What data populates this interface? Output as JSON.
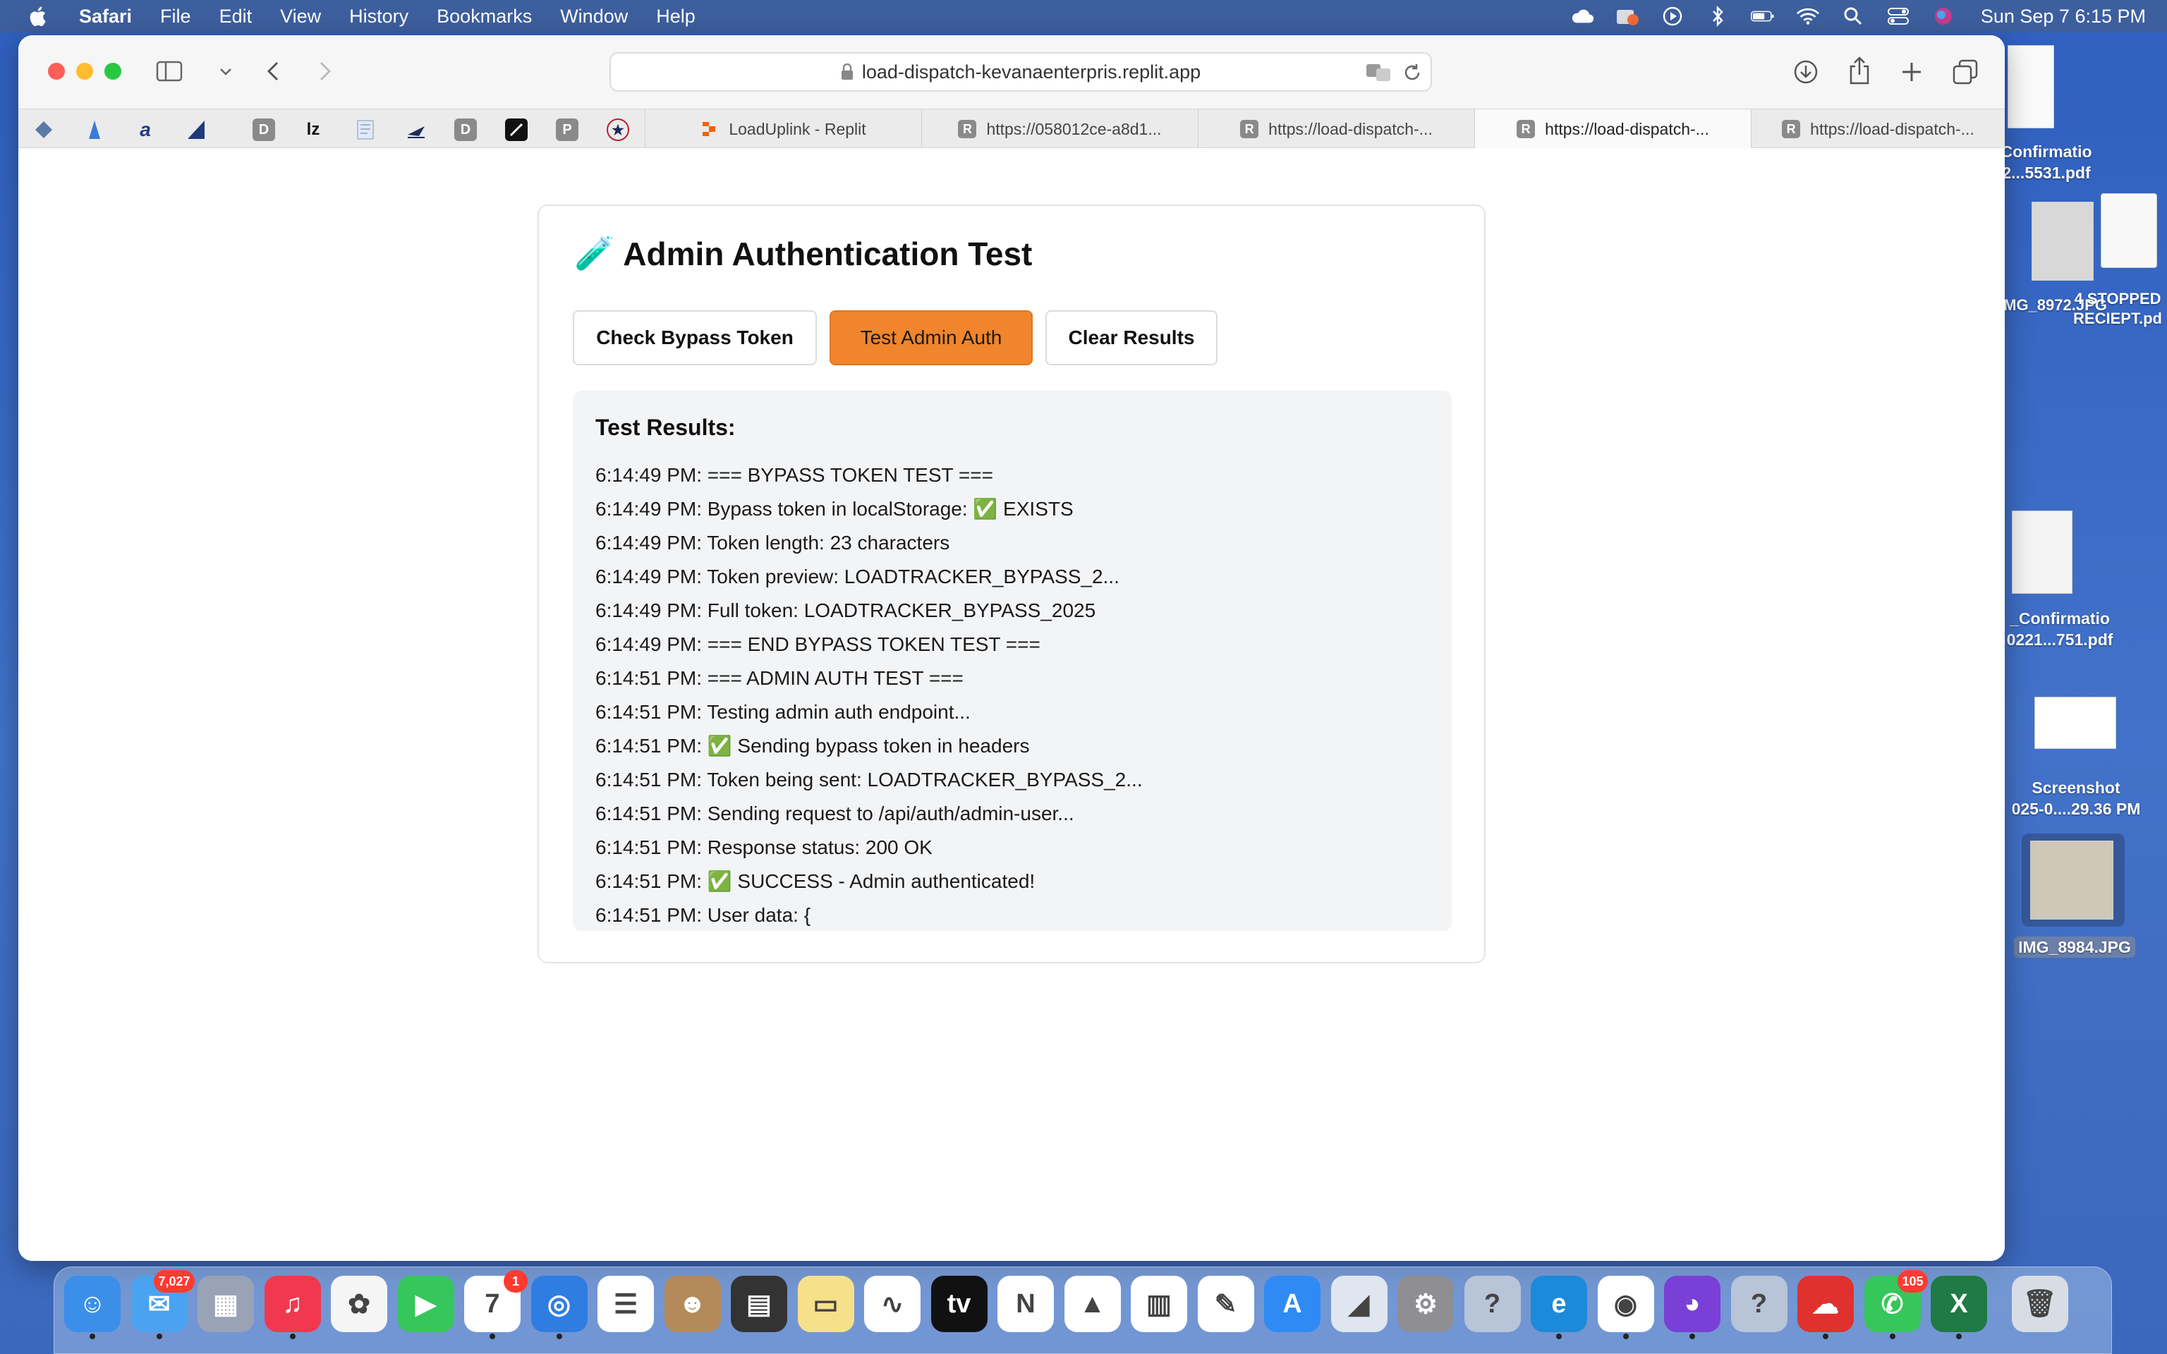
{
  "menubar": {
    "app": "Safari",
    "items": [
      "File",
      "Edit",
      "View",
      "History",
      "Bookmarks",
      "Window",
      "Help"
    ],
    "clock": "Sun Sep 7  6:15 PM"
  },
  "browser": {
    "url": "load-dispatch-kevanaenterpris.replit.app",
    "favorites": [
      {
        "icon": "diamond-icon",
        "color": "#5b7aa6",
        "letter": ""
      },
      {
        "icon": "rocket-icon",
        "color": "#3b7bd6",
        "letter": ""
      },
      {
        "icon": "a-icon",
        "color": "#ffffff",
        "letter": "a"
      },
      {
        "icon": "flag-icon",
        "color": "#1e3a7a",
        "letter": ""
      },
      {
        "icon": "d-icon",
        "color": "#8a8a8a",
        "letter": "D"
      },
      {
        "icon": "lz-icon",
        "color": "#ffffff",
        "letter": "lz"
      },
      {
        "icon": "doc-icon",
        "color": "#c9d6e8",
        "letter": ""
      },
      {
        "icon": "plane-icon",
        "color": "#ffffff",
        "letter": ""
      },
      {
        "icon": "d-icon",
        "color": "#8a8a8a",
        "letter": "D"
      },
      {
        "icon": "pen-icon",
        "color": "#111111",
        "letter": ""
      },
      {
        "icon": "p-icon",
        "color": "#8a8a8a",
        "letter": "P"
      },
      {
        "icon": "star-icon",
        "color": "#ffffff",
        "letter": "★"
      }
    ],
    "tabs": [
      {
        "label": "LoadUplink - Replit",
        "icon": "replit-icon"
      },
      {
        "label": "https://058012ce-a8d1...",
        "icon": "R"
      },
      {
        "label": "https://load-dispatch-...",
        "icon": "R"
      },
      {
        "label": "https://load-dispatch-...",
        "icon": "R"
      },
      {
        "label": "https://load-dispatch-...",
        "icon": "R"
      }
    ]
  },
  "page": {
    "title": "Admin Authentication Test",
    "title_emoji": "🧪",
    "buttons": {
      "check": "Check Bypass Token",
      "test": "Test Admin Auth",
      "clear": "Clear Results"
    },
    "results_heading": "Test Results:",
    "log": [
      "6:14:49 PM: === BYPASS TOKEN TEST ===",
      "6:14:49 PM: Bypass token in localStorage: ✅ EXISTS",
      "6:14:49 PM: Token length: 23 characters",
      "6:14:49 PM: Token preview: LOADTRACKER_BYPASS_2...",
      "6:14:49 PM: Full token: LOADTRACKER_BYPASS_2025",
      "6:14:49 PM: === END BYPASS TOKEN TEST ===",
      "6:14:51 PM: === ADMIN AUTH TEST ===",
      "6:14:51 PM: Testing admin auth endpoint...",
      "6:14:51 PM: ✅ Sending bypass token in headers",
      "6:14:51 PM: Token being sent: LOADTRACKER_BYPASS_2...",
      "6:14:51 PM: Sending request to /api/auth/admin-user...",
      "6:14:51 PM: Response status: 200 OK",
      "6:14:51 PM: ✅ SUCCESS - Admin authenticated!",
      "6:14:51 PM: User data: {"
    ]
  },
  "desktop": {
    "icons": [
      {
        "label1": "Confirmatio",
        "label2": "2...5531.pdf"
      },
      {
        "label1": "IMG_8972.JPG",
        "label2": ""
      },
      {
        "label1": "4 STOPPED",
        "label2": "RECIEPT.pd"
      },
      {
        "label1": "_Confirmatio",
        "label2": "0221...751.pdf"
      },
      {
        "label1": "Screenshot",
        "label2": "025-0....29.36 PM"
      },
      {
        "label1": "IMG_8984.JPG",
        "label2": ""
      }
    ]
  },
  "dock": {
    "apps": [
      {
        "name": "finder-icon",
        "color": "#3b8fe8",
        "badge": ""
      },
      {
        "name": "mail-icon",
        "color": "#4aa3f0",
        "badge": "7,027"
      },
      {
        "name": "launchpad-icon",
        "color": "#9aa3b5",
        "badge": ""
      },
      {
        "name": "music-icon",
        "color": "#f2384f",
        "badge": ""
      },
      {
        "name": "photos-icon",
        "color": "#f5f5f5",
        "badge": ""
      },
      {
        "name": "facetime-icon",
        "color": "#35c759",
        "badge": ""
      },
      {
        "name": "calendar-icon",
        "color": "#ffffff",
        "badge": "1"
      },
      {
        "name": "safari-icon",
        "color": "#2f7de1",
        "badge": ""
      },
      {
        "name": "reminders-icon",
        "color": "#ffffff",
        "badge": ""
      },
      {
        "name": "contacts-icon",
        "color": "#b48a5a",
        "badge": ""
      },
      {
        "name": "calculator-icon",
        "color": "#333333",
        "badge": ""
      },
      {
        "name": "notes-icon",
        "color": "#f7e08a",
        "badge": ""
      },
      {
        "name": "freeform-icon",
        "color": "#ffffff",
        "badge": ""
      },
      {
        "name": "tv-icon",
        "color": "#111111",
        "badge": ""
      },
      {
        "name": "news-icon",
        "color": "#ffffff",
        "badge": ""
      },
      {
        "name": "keynote-icon",
        "color": "#ffffff",
        "badge": ""
      },
      {
        "name": "numbers-icon",
        "color": "#ffffff",
        "badge": ""
      },
      {
        "name": "pages-icon",
        "color": "#ffffff",
        "badge": ""
      },
      {
        "name": "appstore-icon",
        "color": "#2f8af5",
        "badge": ""
      },
      {
        "name": "xcode-like-icon",
        "color": "#dfe6f0",
        "badge": ""
      },
      {
        "name": "settings-icon",
        "color": "#8e8e93",
        "badge": ""
      },
      {
        "name": "unknown-icon",
        "color": "#b8c4d8",
        "badge": ""
      },
      {
        "name": "edge-icon",
        "color": "#1c8ad8",
        "badge": ""
      },
      {
        "name": "chrome-icon",
        "color": "#ffffff",
        "badge": ""
      },
      {
        "name": "firefox-icon",
        "color": "#7a3fd6",
        "badge": ""
      },
      {
        "name": "unknown-icon",
        "color": "#b8c4d8",
        "badge": ""
      },
      {
        "name": "creative-cloud-icon",
        "color": "#e0312f",
        "badge": ""
      },
      {
        "name": "messages-icon",
        "color": "#35c759",
        "badge": "105"
      },
      {
        "name": "excel-icon",
        "color": "#1f7a43",
        "badge": ""
      },
      {
        "name": "trash-icon",
        "color": "#d8dde5",
        "badge": ""
      }
    ]
  }
}
